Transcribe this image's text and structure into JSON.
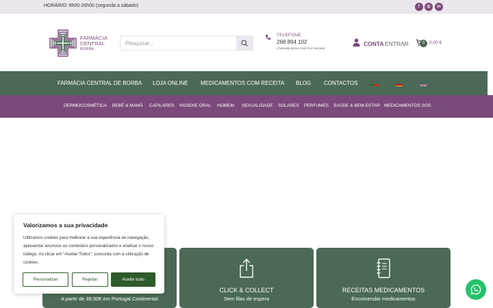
{
  "topbar": {
    "hours": "HORÁRIO: 9h00-20h00 (segunda a sábado)",
    "social": [
      {
        "icon": "facebook-icon",
        "glyph": "f"
      },
      {
        "icon": "instagram-icon",
        "glyph": "◎"
      },
      {
        "icon": "linkedin-icon",
        "glyph": "in"
      }
    ]
  },
  "logo": {
    "line1": "FARMÁCIA",
    "line2": "CENTRAL",
    "line3": "BORBA"
  },
  "search": {
    "placeholder": "Pesquisar..."
  },
  "phone": {
    "label": "TELEFONE",
    "number": "268 894 102",
    "note": "Chamada para a rede fixa nacional"
  },
  "account": {
    "label": "CONTA",
    "login": "ENTRAR"
  },
  "cart": {
    "count": "0",
    "total": "0,00 €"
  },
  "main_nav": [
    "FARMÁCIA CENTRAL DE BORBA",
    "LOJA ONLINE",
    "MEDICAMENTOS COM RECEITA",
    "BLOG",
    "CONTACTOS"
  ],
  "categories": [
    "DERMOCOSMÉTICA",
    "BEBÉ & MAMÃ",
    "CAPILARES",
    "HIGIENE ORAL",
    "HOMEM",
    "SEXUALIDADE",
    "SOLARES",
    "PERFUMES",
    "SAÚDE & BEM-ESTAR",
    "MEDICAMENTOS SOS"
  ],
  "cards": [
    {
      "title": "",
      "subtitle": "A partir de 39,90€ em Portugal Continental"
    },
    {
      "title": "CLICK & COLLECT",
      "subtitle": "Sem filas de espera"
    },
    {
      "title": "RECEITAS MEDICAMENTOS",
      "subtitle": "Encomendar medicamentos"
    }
  ],
  "cookie": {
    "title": "Valorizamos a sua privacidade",
    "body": "Utilizamos cookies para melhorar a sua experiência de navegação, apresentar anúncios ou conteúdos personalizados e analisar o nosso tráfego. Ao clicar em \"Aceitar Todos\", concorda com a utilização de cookies.",
    "customize": "Personalizar",
    "reject": "Rejeitar",
    "accept": "Aceite tudo"
  },
  "colors": {
    "green": "#4a6a55",
    "purple": "#7c4a7a",
    "cookie_green": "#2f5a2a",
    "whatsapp": "#25c26a"
  }
}
